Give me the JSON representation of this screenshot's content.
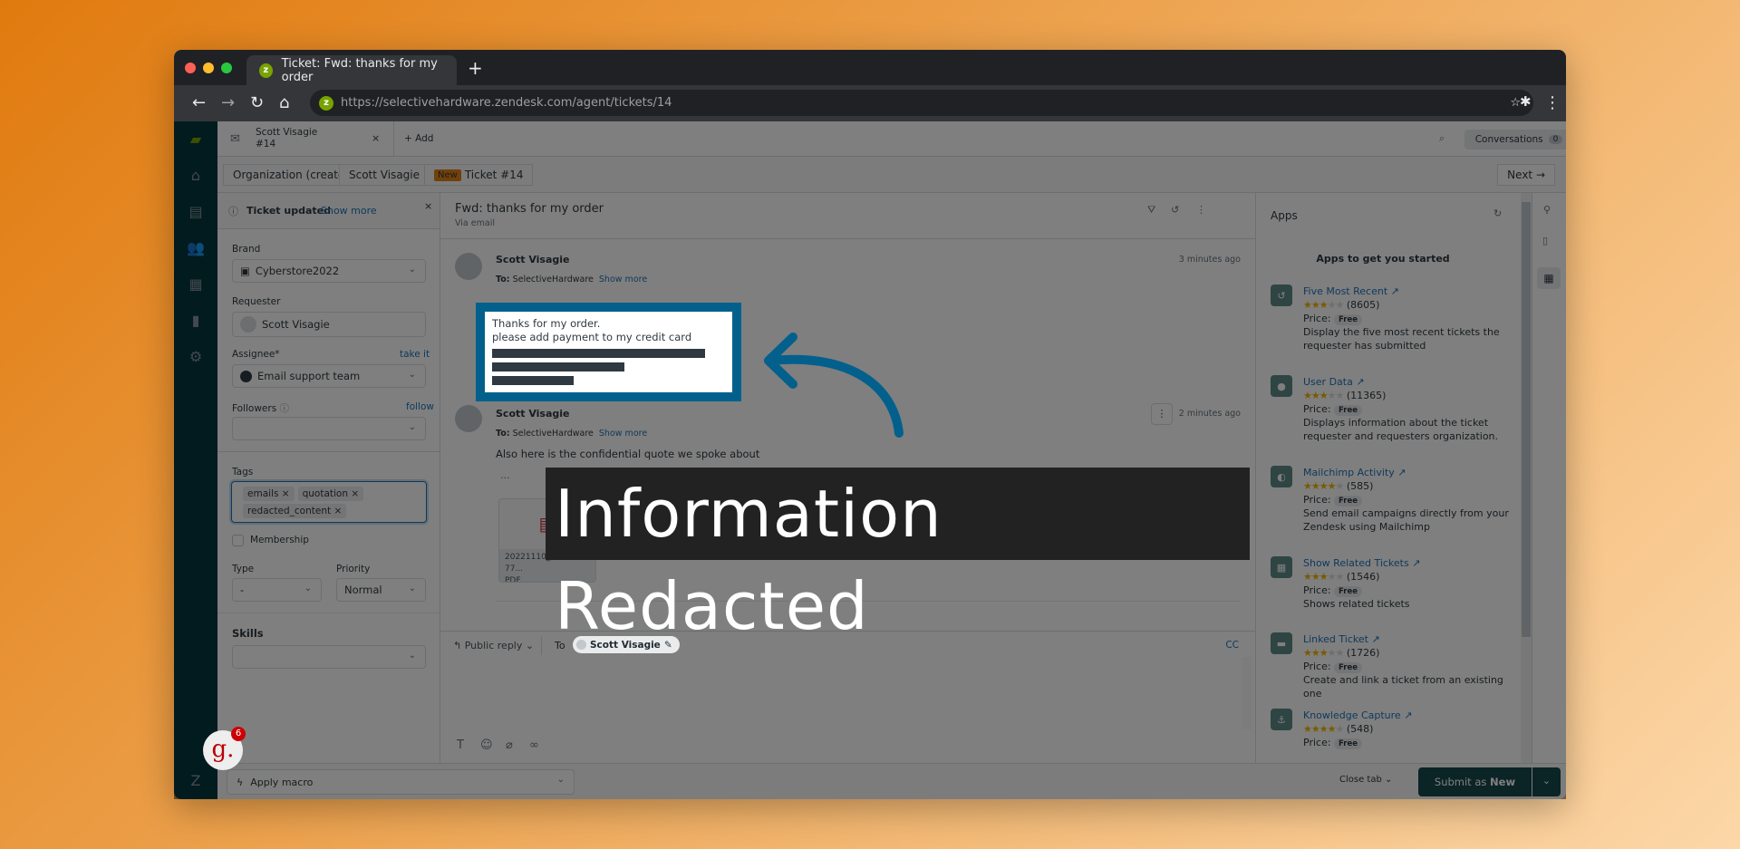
{
  "browser": {
    "tab_title": "Ticket: Fwd: thanks for my order",
    "url": "https://selectivehardware.zendesk.com/agent/tickets/14",
    "new_tab": "+"
  },
  "header": {
    "ticket_tab_name": "Scott Visagie",
    "ticket_tab_number": "#14",
    "add_label": "+ Add",
    "conversations_label": "Conversations",
    "conversations_count": "0"
  },
  "breadcrumbs": {
    "organization": "Organization (create)",
    "requester": "Scott Visagie",
    "status_badge": "New",
    "ticket": "Ticket #14",
    "next": "Next →"
  },
  "left_panel": {
    "notice": "Ticket updated",
    "show_more": "Show more",
    "brand_label": "Brand",
    "brand_value": "Cyberstore2022",
    "requester_label": "Requester",
    "requester_value": "Scott Visagie",
    "assignee_label": "Assignee*",
    "take_it": "take it",
    "assignee_value": "Email support team",
    "followers_label": "Followers",
    "follow": "follow",
    "tags_label": "Tags",
    "tags": [
      "emails",
      "quotation",
      "redacted_content"
    ],
    "membership_label": "Membership",
    "type_label": "Type",
    "type_value": "-",
    "priority_label": "Priority",
    "priority_value": "Normal",
    "skills_label": "Skills"
  },
  "conversation": {
    "subject": "Fwd: thanks for my order",
    "channel": "Via email",
    "messages": [
      {
        "author": "Scott Visagie",
        "to_label": "To:",
        "to": "SelectiveHardware",
        "show_more": "Show more",
        "time": "3 minutes ago",
        "lines": [
          "Thanks for my order.",
          "please add payment to my credit card"
        ]
      },
      {
        "author": "Scott Visagie",
        "to_label": "To:",
        "to": "SelectiveHardware",
        "show_more": "Show more",
        "time": "2 minutes ago",
        "lines": [
          "Also here is the confidential quote we spoke about"
        ],
        "attachment": {
          "name": "20221110_Quote 77...",
          "type": "PDF"
        }
      }
    ],
    "reply": {
      "mode": "Public reply",
      "to_label": "To",
      "recipient": "Scott Visagie",
      "cc": "CC"
    }
  },
  "apps": {
    "title": "Apps",
    "subtitle": "Apps to get you started",
    "price_label": "Price:",
    "free_label": "Free",
    "items": [
      {
        "name": "Five Most Recent",
        "rating": 3,
        "reviews": "(8605)",
        "description": "Display the five most recent tickets the requester has submitted"
      },
      {
        "name": "User Data",
        "rating": 3,
        "reviews": "(11365)",
        "description": "Displays information about the ticket requester and requesters organization."
      },
      {
        "name": "Mailchimp Activity",
        "rating": 4,
        "reviews": "(585)",
        "description": "Send email campaigns directly from your Zendesk using Mailchimp"
      },
      {
        "name": "Show Related Tickets",
        "rating": 3,
        "reviews": "(1546)",
        "description": "Shows related tickets"
      },
      {
        "name": "Linked Ticket",
        "rating": 3,
        "reviews": "(1726)",
        "description": "Create and link a ticket from an existing one"
      },
      {
        "name": "Knowledge Capture",
        "rating": 4,
        "reviews": "(548)",
        "description": ""
      }
    ]
  },
  "footer": {
    "apply_macro": "Apply macro",
    "close_tab": "Close tab",
    "submit_prefix": "Submit as ",
    "submit_status": "New"
  },
  "annotation": {
    "banner": "Information Redacted",
    "highlight_color": "#03608c"
  },
  "chat_widget": {
    "letter": "g.",
    "badge": "6"
  }
}
